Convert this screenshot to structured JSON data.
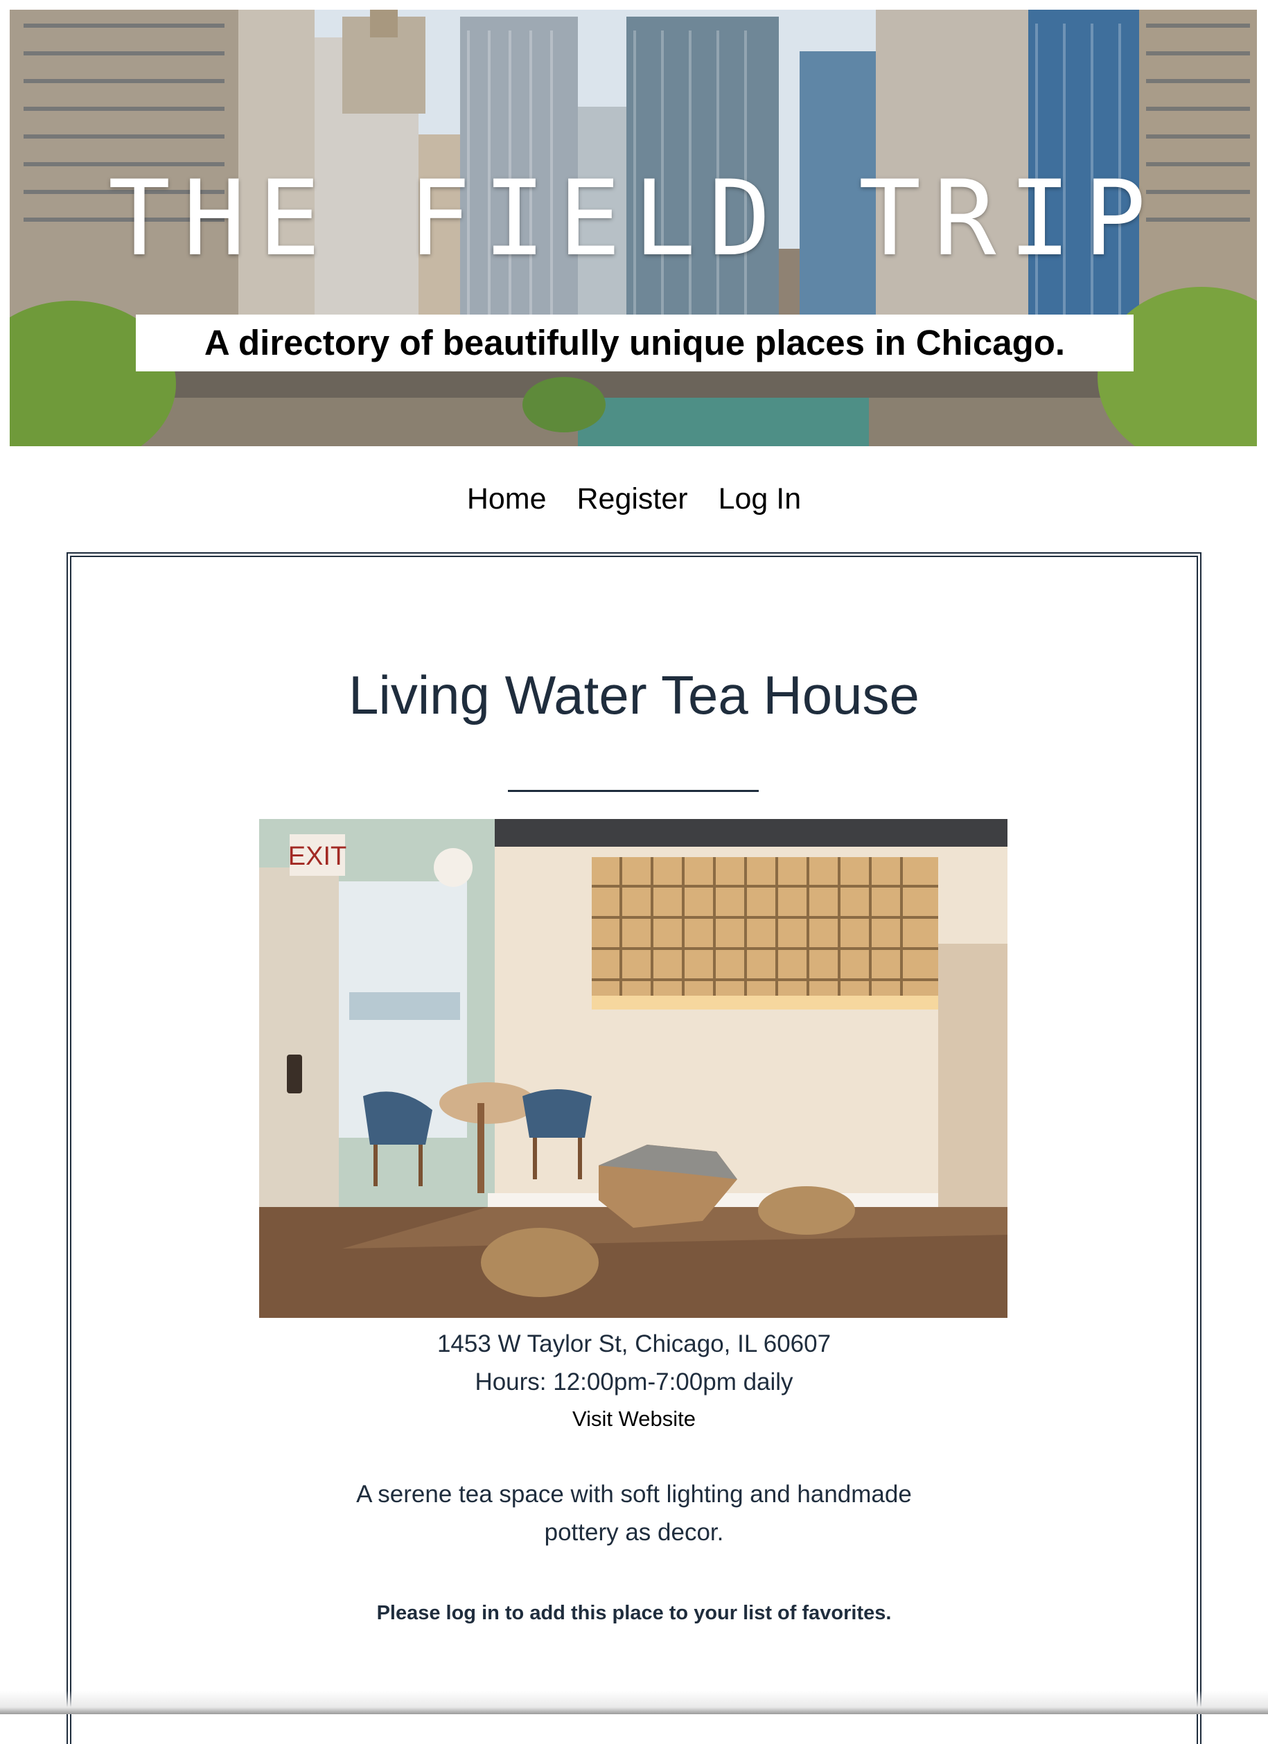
{
  "site": {
    "title": "THE FIELD TRIP",
    "tagline": "A directory of beautifully unique places in Chicago."
  },
  "nav": {
    "items": [
      {
        "label": "Home"
      },
      {
        "label": "Register"
      },
      {
        "label": "Log In"
      }
    ]
  },
  "place": {
    "name": "Living Water Tea House",
    "address": "1453 W Taylor St, Chicago, IL 60607",
    "hours": "Hours: 12:00pm-7:00pm daily",
    "website_label": "Visit Website",
    "description": "A serene tea space with soft lighting and handmade pottery as decor.",
    "login_prompt": "Please log in to add this place to your list of favorites.",
    "photo_sign": "EXIT"
  },
  "colors": {
    "text": "#1f2d3d",
    "border": "#1f2d3d",
    "nav_text": "#000000"
  }
}
